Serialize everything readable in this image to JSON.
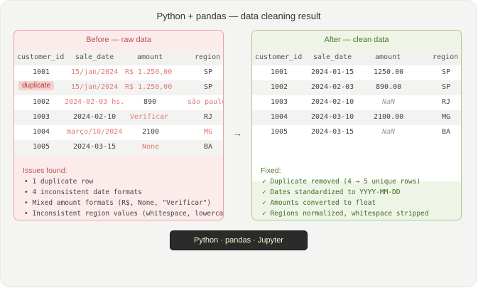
{
  "title": "Python + pandas — data cleaning result",
  "before": {
    "title": "Before — raw data",
    "headers": [
      "customer_id",
      "sale_date",
      "amount",
      "region"
    ],
    "rows": [
      [
        "1001",
        "15/jan/2024",
        "R$ 1.250,00",
        "SP"
      ],
      [
        "duplicate",
        "15/jan/2024",
        "R$ 1.250,00",
        "SP"
      ],
      [
        "1002",
        "2024-02-03 hs.",
        "890",
        "são paulo"
      ],
      [
        "1003",
        "2024-02-10",
        "Verificar",
        "RJ"
      ],
      [
        "1004",
        "março/10/2024",
        "2100",
        "MG"
      ],
      [
        "1005",
        "2024-03-15",
        "None",
        "BA"
      ]
    ],
    "notes_title": "Issues found:",
    "notes": [
      "• 1 duplicate row",
      "• 4 inconsistent date formats",
      "• Mixed amount formats (R$, None, \"Verificar\")",
      "• Inconsistent region values (whitespace, lowercase)"
    ]
  },
  "after": {
    "title": "After — clean data",
    "headers": [
      "customer_id",
      "sale_date",
      "amount",
      "region"
    ],
    "rows": [
      [
        "1001",
        "2024-01-15",
        "1250.00",
        "SP"
      ],
      [
        "1002",
        "2024-02-03",
        "890.00",
        "SP"
      ],
      [
        "1003",
        "2024-02-10",
        "NaN",
        "RJ"
      ],
      [
        "1004",
        "2024-03-10",
        "2100.00",
        "MG"
      ],
      [
        "1005",
        "2024-03-15",
        "NaN",
        "BA"
      ]
    ],
    "notes_title": "Fixed:",
    "notes": [
      "✓ Duplicate removed (4 → 5 unique rows)",
      "✓ Dates standardized to YYYY-MM-DD",
      "✓ Amounts converted to float",
      "✓ Regions normalized, whitespace stripped"
    ]
  },
  "arrow": "→",
  "footer_badge": "Python · pandas · Jupyter",
  "colors": {
    "before_border": "#e9a2a0",
    "after_border": "#a9cd8a",
    "badge_bg": "#2b2b2b"
  }
}
